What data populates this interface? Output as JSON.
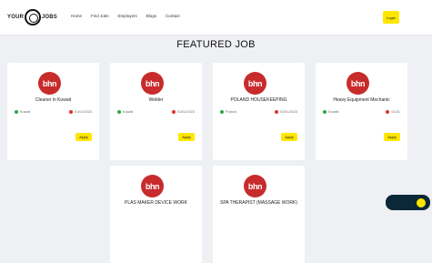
{
  "header": {
    "logo_text": "",
    "nav": [
      "Home",
      "Find Jobs",
      "Employers",
      "Blogs",
      "Contact"
    ],
    "login_label": "Login"
  },
  "section_title": "FEATURED JOB",
  "cards": [
    {
      "badge": "bhn",
      "title": "Cleaner in Kuwait",
      "location": "Kuwait",
      "date": "01/01/2023",
      "salary": "",
      "apply_label": "Apply"
    },
    {
      "badge": "bhn",
      "title": "Welder",
      "location": "Kuwait",
      "date": "01/01/2023",
      "salary": "",
      "apply_label": "Apply"
    },
    {
      "badge": "bhn",
      "title": "POLAND HOUSEKEEPING",
      "location": "Poland",
      "date": "01/01/2023",
      "salary": "",
      "apply_label": "Apply"
    },
    {
      "badge": "bhn",
      "title": "Heavy Equipment Mechanic",
      "location": "Kuwait",
      "date": "01/01",
      "salary": "",
      "apply_label": "Apply"
    },
    {
      "badge": "bhn",
      "title": "PLAS MAKER DEVICE WORK",
      "location": "",
      "date": "",
      "salary": "",
      "apply_label": "Apply"
    },
    {
      "badge": "bhn",
      "title": "SPA THERAPIST (MASSAGE WORK)",
      "location": "",
      "date": "",
      "salary": "",
      "apply_label": "Apply"
    }
  ],
  "chat": {
    "label": "",
    "sub_label": ""
  },
  "colors": {
    "accent_yellow": "#ffe600",
    "badge_red": "#c82b2b",
    "chat_bg": "#0b2838"
  }
}
